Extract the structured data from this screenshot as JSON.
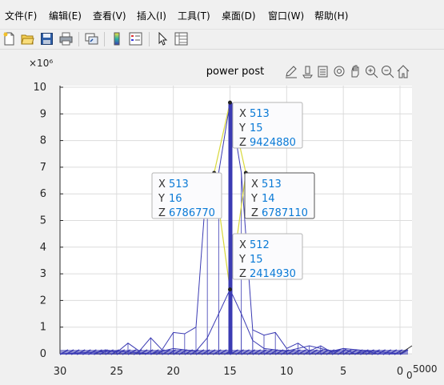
{
  "menu": [
    "文件(F)",
    "编辑(E)",
    "查看(V)",
    "插入(I)",
    "工具(T)",
    "桌面(D)",
    "窗口(W)",
    "帮助(H)"
  ],
  "toolbar_icons": [
    "new-figure-icon",
    "open-file-icon",
    "save-icon",
    "print-icon",
    "link-plot-icon",
    "colorbar-icon",
    "legend-icon",
    "pointer-icon",
    "property-inspector-icon"
  ],
  "axes_toolbar_icons": [
    "brush-icon",
    "data-tips-icon",
    "export-icon",
    "rotate-icon",
    "pan-icon",
    "zoom-in-icon",
    "zoom-out-icon",
    "home-icon"
  ],
  "colors": {
    "mesh": "#3b3bb3",
    "highlight": "#d8d83a",
    "datatip_value": "#0a7ad6"
  },
  "chart_data": {
    "type": "mesh",
    "title": "power post",
    "z_exponent": "×10⁶",
    "x_ticks": [
      "30",
      "25",
      "20",
      "15",
      "10",
      "5",
      "0"
    ],
    "z_ticks": [
      "0",
      "1",
      "2",
      "3",
      "4",
      "5",
      "6",
      "7",
      "8",
      "9",
      "10"
    ],
    "depth_tick": "0",
    "depth_max_tick": "5000",
    "xlim": [
      0,
      30
    ],
    "zlim": [
      0,
      10000000
    ],
    "grid": true,
    "profile_back": {
      "x": [
        30,
        27,
        26,
        25,
        24,
        23,
        22,
        21,
        20,
        19,
        18,
        17,
        16,
        15,
        14,
        13,
        12,
        11,
        10,
        9,
        8,
        7,
        6,
        5,
        4,
        3,
        2,
        1,
        0
      ],
      "z": [
        0,
        0,
        150000,
        50000,
        400000,
        100000,
        600000,
        150000,
        800000,
        750000,
        1000000,
        6786770,
        6786770,
        9424880,
        6787110,
        900000,
        700000,
        800000,
        200000,
        400000,
        100000,
        300000,
        50000,
        200000,
        0,
        100000,
        0,
        0,
        0
      ]
    },
    "profile_front": {
      "x": [
        30,
        25,
        22,
        20,
        18,
        17,
        16,
        15,
        14,
        13,
        12,
        10,
        8,
        6,
        5,
        0
      ],
      "z": [
        0,
        100000,
        0,
        200000,
        100000,
        600000,
        1500000,
        2414930,
        1500000,
        500000,
        200000,
        100000,
        300000,
        100000,
        200000,
        0
      ]
    },
    "datatips": [
      {
        "x_label": "X",
        "x": "513",
        "y_label": "Y",
        "y": "15",
        "z_label": "Z",
        "z": "9424880",
        "px": 15,
        "pz": 9424880
      },
      {
        "x_label": "X",
        "x": "513",
        "y_label": "Y",
        "y": "16",
        "z_label": "Z",
        "z": "6786770",
        "px": 16.4,
        "pz": 6786770
      },
      {
        "x_label": "X",
        "x": "513",
        "y_label": "Y",
        "y": "14",
        "z_label": "Z",
        "z": "6787110",
        "px": 13.6,
        "pz": 6787110
      },
      {
        "x_label": "X",
        "x": "512",
        "y_label": "Y",
        "y": "15",
        "z_label": "Z",
        "z": "2414930",
        "px": 15,
        "pz": 2414930
      }
    ]
  }
}
